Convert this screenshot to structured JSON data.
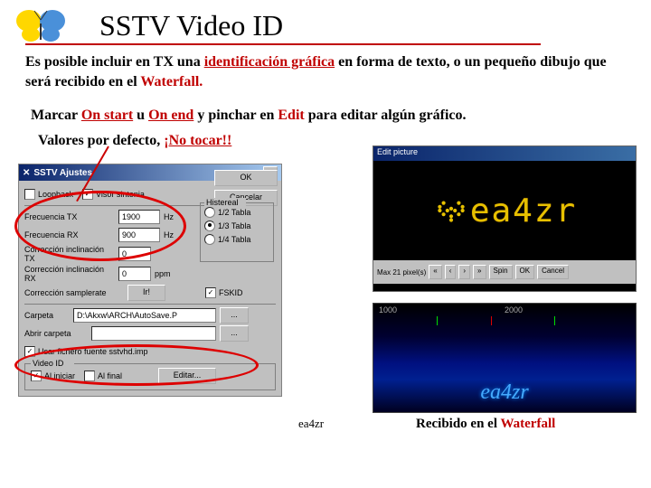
{
  "header": {
    "title": "SSTV  Video ID"
  },
  "para1": {
    "t1": "Es posible incluir en TX una ",
    "t2": "identificación gráfica",
    "t3": " en forma de texto, o un pequeño dibujo que será recibido en el ",
    "t4": "Waterfall."
  },
  "para2": {
    "t1": "Marcar ",
    "t2": "On start",
    "t3": " u ",
    "t4": "On end",
    "t5": " y pinchar en ",
    "t6": "Edit",
    "t7": " para editar algún gráfico."
  },
  "para3": {
    "t1": "Valores por defecto, ",
    "t2": "¡No tocar!!"
  },
  "dialog": {
    "title": "SSTV Ajustes",
    "chk_loopback": "Loopback",
    "chk_sintonia": "Visor sintonia",
    "btn_ok": "OK",
    "btn_cancel": "Cancelar",
    "freq_tx_lbl": "Frecuencia TX",
    "freq_tx_val": "1900",
    "hz": "Hz",
    "freq_rx_lbl": "Frecuencia RX",
    "freq_rx_val": "900",
    "incl_lbl": "Corrección inclinación TX",
    "incl_val": "0",
    "inclrx_lbl": "Corrección inclinación RX",
    "inclrx_val": "0",
    "ppm": "ppm",
    "samplecorr": "Corrección samplerate",
    "ir": "Ir!",
    "hist_title": "Histereal",
    "hist_12": "1/2 Tabla",
    "hist_13": "1/3 Tabla",
    "hist_14": "1/4 Tabla",
    "fskid": "FSKID",
    "folder_lbl": "Carpeta",
    "folder_val": "D:\\Akxw\\ARCH\\AutoSave.P",
    "open_lbl": "Abrir carpeta",
    "use_font": "Usar fichero fuente sstvhd.imp",
    "video_id": "Video ID",
    "on_start": "Al iniciar",
    "on_end": "Al final",
    "edit": "Editar..."
  },
  "editor": {
    "title": "Edit picture",
    "callsign": "ea4zr",
    "max": "Max 21 pixel(s)",
    "spin": "Spin",
    "ok": "OK",
    "cancel": "Cancel"
  },
  "waterfall": {
    "s1": "1000",
    "s2": "2000",
    "text": "ea4zr"
  },
  "footer": {
    "left": "ea4zr",
    "r1": "Recibido en el ",
    "r2": "Waterfall"
  }
}
